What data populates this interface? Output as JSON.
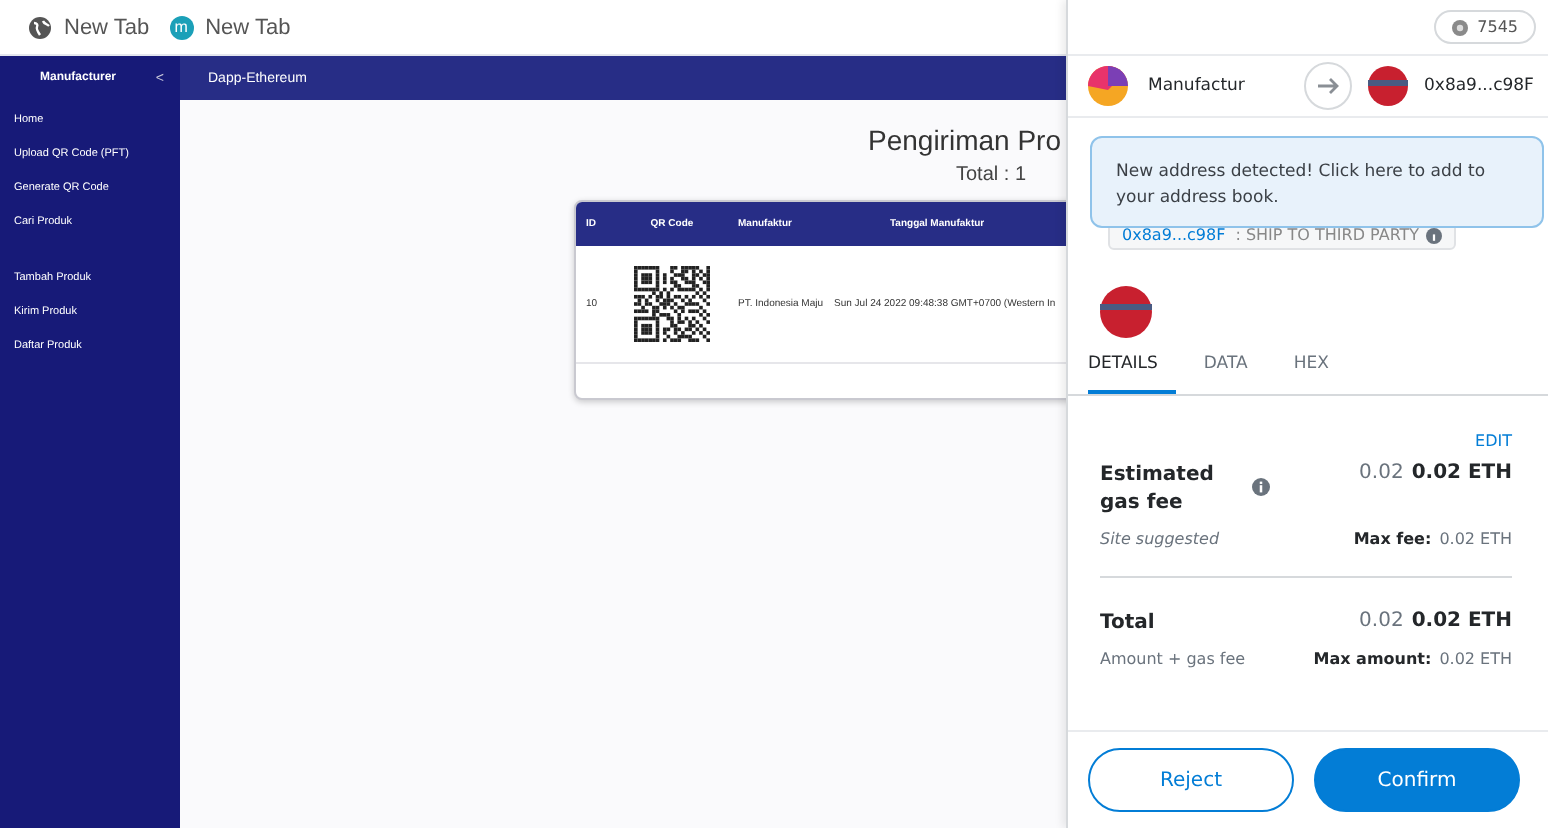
{
  "browser_tabs": [
    {
      "kind": "globe",
      "label": "New Tab"
    },
    {
      "kind": "letter",
      "badge": "m",
      "label": "New Tab"
    }
  ],
  "sidebar": {
    "title": "Manufacturer",
    "collapse": "<",
    "sections": [
      {
        "items": [
          {
            "label": "Home"
          },
          {
            "label": "Upload QR Code (PFT)"
          },
          {
            "label": "Generate QR Code"
          },
          {
            "label": "Cari Produk"
          }
        ]
      },
      {
        "items": [
          {
            "label": "Tambah Produk"
          },
          {
            "label": "Kirim Produk"
          },
          {
            "label": "Daftar Produk"
          }
        ]
      }
    ]
  },
  "header": {
    "title": "Dapp-Ethereum"
  },
  "page": {
    "title": "Pengiriman Pro",
    "subtitle": "Total : 1"
  },
  "table": {
    "columns": [
      "ID",
      "QR Code",
      "Manufaktur",
      "Tanggal Manufaktur"
    ],
    "rows": [
      {
        "id": "10",
        "manufacturer": "PT. Indonesia Maju",
        "date": "Sun Jul 24 2022 09:48:38 GMT+0700 (Western In"
      }
    ]
  },
  "wallet": {
    "network_badge": "7545",
    "from": {
      "name": "Manufactur"
    },
    "to": {
      "address": "0x8a9...c98F"
    },
    "notice": "New address detected! Click here to add to your address book.",
    "method": {
      "address": "0x8a9...c98F",
      "action": ": SHIP TO THIRD PARTY"
    },
    "tabs": [
      {
        "label": "DETAILS",
        "selected": true
      },
      {
        "label": "DATA",
        "selected": false
      },
      {
        "label": "HEX",
        "selected": false
      }
    ],
    "edit": "EDIT",
    "rows": [
      {
        "kind": "fee",
        "label": "Estimated gas fee",
        "info": true,
        "amount": "0.02",
        "amount_eth": "0.02 ETH",
        "note": "Site suggested",
        "max_label": "Max fee:",
        "max_value": "0.02 ETH"
      },
      {
        "kind": "total",
        "label": "Total",
        "info": false,
        "amount": "0.02",
        "amount_eth": "0.02 ETH",
        "note": "Amount + gas fee",
        "max_label": "Max amount:",
        "max_value": "0.02 ETH"
      }
    ],
    "buttons": [
      {
        "kind": "secondary",
        "label": "Reject"
      },
      {
        "kind": "primary",
        "label": "Confirm"
      }
    ]
  }
}
